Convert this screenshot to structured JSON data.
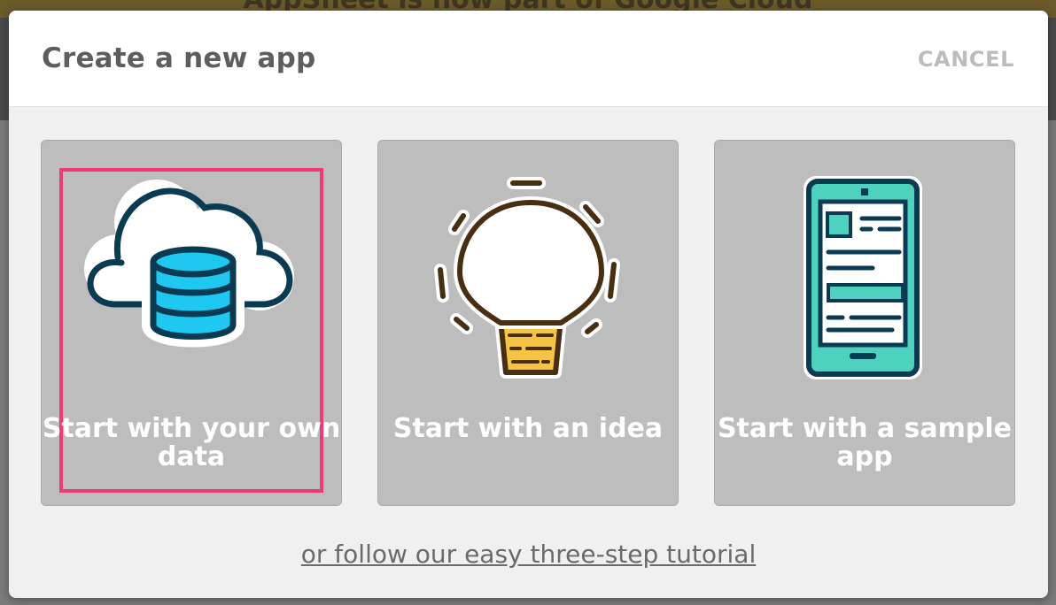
{
  "background": {
    "banner_text": "AppSheet is now part of Google Cloud"
  },
  "dialog": {
    "title": "Create a new app",
    "cancel_label": "CANCEL",
    "options": [
      {
        "label": "Start with your own data",
        "icon": "cloud-database-icon",
        "selected": true
      },
      {
        "label": "Start with an idea",
        "icon": "lightbulb-icon",
        "selected": false
      },
      {
        "label": "Start with a sample app",
        "icon": "phone-app-icon",
        "selected": false
      }
    ],
    "tutorial_link": "or follow our easy three-step tutorial"
  },
  "colors": {
    "card_bg": "#bdbdbd",
    "selection_outline": "#f0397a",
    "icon_outline": "#0b3a53",
    "database_fill": "#1ec8f0",
    "bulb_base": "#f6c445",
    "bulb_outline": "#4a2e12",
    "phone_fill": "#4fd1c0"
  }
}
